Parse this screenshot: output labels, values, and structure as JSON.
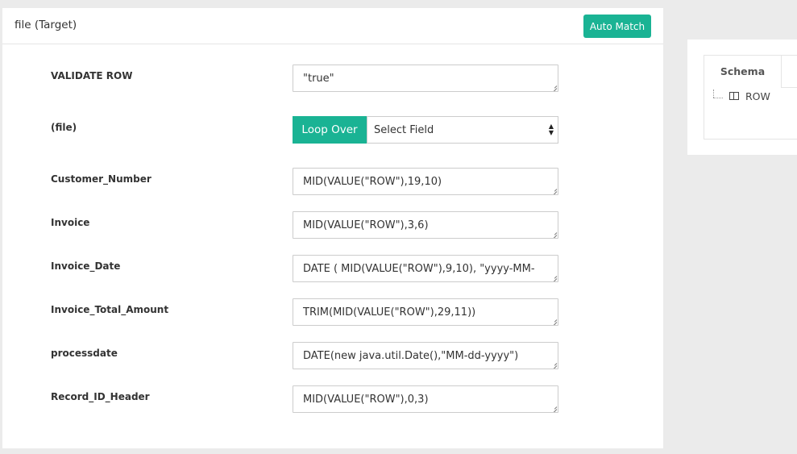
{
  "panel": {
    "title": "file (Target)",
    "auto_match_label": "Auto Match"
  },
  "fields": [
    {
      "label": "VALIDATE ROW",
      "value": "\"true\""
    },
    {
      "label": "(file)"
    },
    {
      "label": "Customer_Number",
      "value": "MID(VALUE(\"ROW\"),19,10)"
    },
    {
      "label": "Invoice",
      "value": "MID(VALUE(\"ROW\"),3,6)"
    },
    {
      "label": "Invoice_Date",
      "value": "DATE ( MID(VALUE(\"ROW\"),9,10), \"yyyy-MM-"
    },
    {
      "label": "Invoice_Total_Amount",
      "value": "TRIM(MID(VALUE(\"ROW\"),29,11))"
    },
    {
      "label": "processdate",
      "value": "DATE(new java.util.Date(),\"MM-dd-yyyy\")"
    },
    {
      "label": "Record_ID_Header",
      "value": "MID(VALUE(\"ROW\"),0,3)"
    }
  ],
  "loop": {
    "button_label": "Loop Over",
    "select_value": "Select Field"
  },
  "schema": {
    "tab_label": "Schema",
    "tree_item": "ROW"
  },
  "colors": {
    "accent": "#1ab394"
  }
}
